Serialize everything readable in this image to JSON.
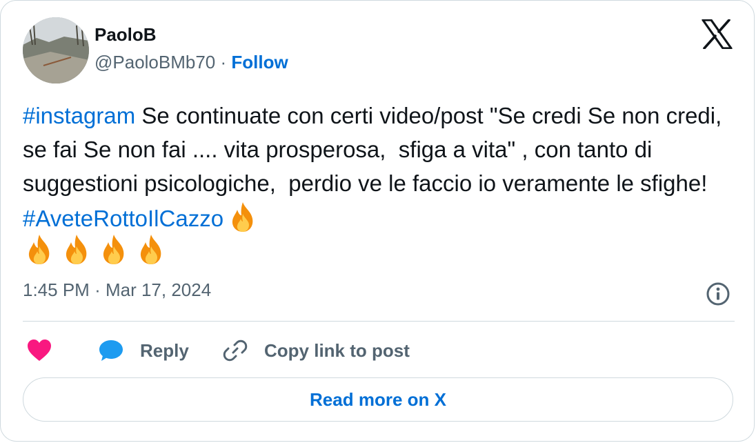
{
  "author": {
    "name": "PaoloB",
    "handle": "@PaoloBMb70",
    "separator": "·",
    "follow_label": "Follow"
  },
  "tweet": {
    "hashtag_1": "#instagram",
    "text_main": " Se continuate con certi video/post \"Se credi Se non credi,  se fai Se non fai .... vita prosperosa,  sfiga a vita\" , con tanto di suggestioni psicologiche,  perdio ve le faccio io veramente le sfighe! ",
    "hashtag_2": "#AveteRottoIlCazzo",
    "emoji": "fire",
    "emoji_count": 5
  },
  "meta": {
    "time": "1:45 PM",
    "separator": "·",
    "date": "Mar 17, 2024"
  },
  "actions": {
    "like_icon": "heart-icon",
    "reply_label": "Reply",
    "copy_label": "Copy link to post"
  },
  "footer": {
    "read_more_label": "Read more on X"
  },
  "colors": {
    "link": "#006fd6",
    "text": "#0f1419",
    "muted": "#536471",
    "border": "#cfd9de",
    "heart": "#f91880",
    "reply_bubble": "#1d9bf0"
  }
}
